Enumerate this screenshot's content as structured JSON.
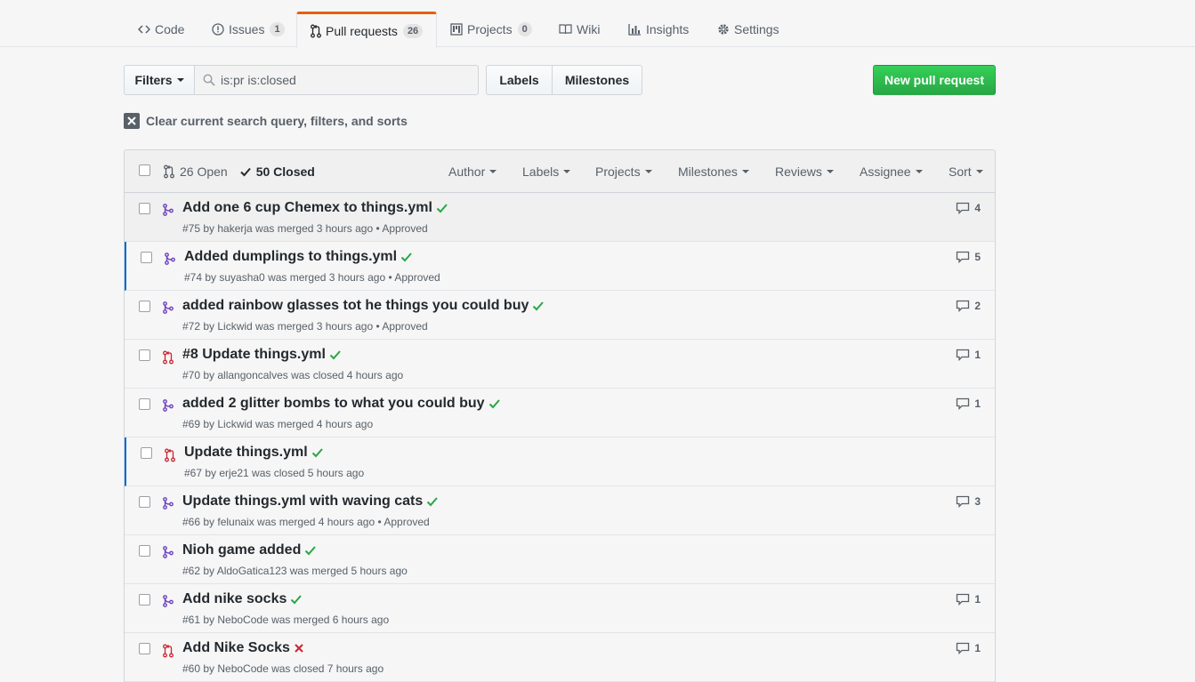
{
  "nav": {
    "tabs": [
      {
        "label": "Code",
        "icon": "code-icon"
      },
      {
        "label": "Issues",
        "icon": "issue-icon",
        "count": "1"
      },
      {
        "label": "Pull requests",
        "icon": "git-pull-request-icon",
        "count": "26"
      },
      {
        "label": "Projects",
        "icon": "project-icon",
        "count": "0"
      },
      {
        "label": "Wiki",
        "icon": "book-icon"
      },
      {
        "label": "Insights",
        "icon": "graph-icon"
      },
      {
        "label": "Settings",
        "icon": "gear-icon"
      }
    ]
  },
  "subnav": {
    "filters_label": "Filters",
    "search_value": "is:pr is:closed",
    "labels_label": "Labels",
    "milestones_label": "Milestones",
    "new_pr_label": "New pull request"
  },
  "clear_query_label": "Clear current search query, filters, and sorts",
  "header": {
    "open_label": "26 Open",
    "closed_label": "50 Closed",
    "filters": [
      "Author",
      "Labels",
      "Projects",
      "Milestones",
      "Reviews",
      "Assignee",
      "Sort"
    ]
  },
  "colors": {
    "merged": "#6f42c1",
    "closed": "#cb2431",
    "success": "#28a745",
    "accent_tab": "#e36209"
  },
  "pulls": [
    {
      "title": "Add one 6 cup Chemex to things.yml",
      "meta": "#75 by hakerja was merged 3 hours ago • Approved",
      "state": "merged",
      "status": "success",
      "comments": "4"
    },
    {
      "title": "Added dumplings to things.yml",
      "meta": "#74 by suyasha0 was merged 3 hours ago • Approved",
      "state": "merged",
      "status": "success",
      "comments": "5"
    },
    {
      "title": "added rainbow glasses tot he things you could buy",
      "meta": "#72 by Lickwid was merged 3 hours ago • Approved",
      "state": "merged",
      "status": "success",
      "comments": "2"
    },
    {
      "title": "#8 Update things.yml",
      "meta": "#70 by allangoncalves was closed 4 hours ago",
      "state": "closed",
      "status": "success",
      "comments": "1"
    },
    {
      "title": "added 2 glitter bombs to what you could buy",
      "meta": "#69 by Lickwid was merged 4 hours ago",
      "state": "merged",
      "status": "success",
      "comments": "1"
    },
    {
      "title": "Update things.yml",
      "meta": "#67 by erje21 was closed 5 hours ago",
      "state": "closed",
      "status": "success",
      "comments": ""
    },
    {
      "title": "Update things.yml with waving cats",
      "meta": "#66 by felunaix was merged 4 hours ago • Approved",
      "state": "merged",
      "status": "success",
      "comments": "3"
    },
    {
      "title": "Nioh game added",
      "meta": "#62 by AldoGatica123 was merged 5 hours ago",
      "state": "merged",
      "status": "success",
      "comments": ""
    },
    {
      "title": "Add nike socks",
      "meta": "#61 by NeboCode was merged 6 hours ago",
      "state": "merged",
      "status": "success",
      "comments": "1"
    },
    {
      "title": "Add Nike Socks",
      "meta": "#60 by NeboCode was closed 7 hours ago",
      "state": "closed",
      "status": "failure",
      "comments": "1"
    }
  ]
}
